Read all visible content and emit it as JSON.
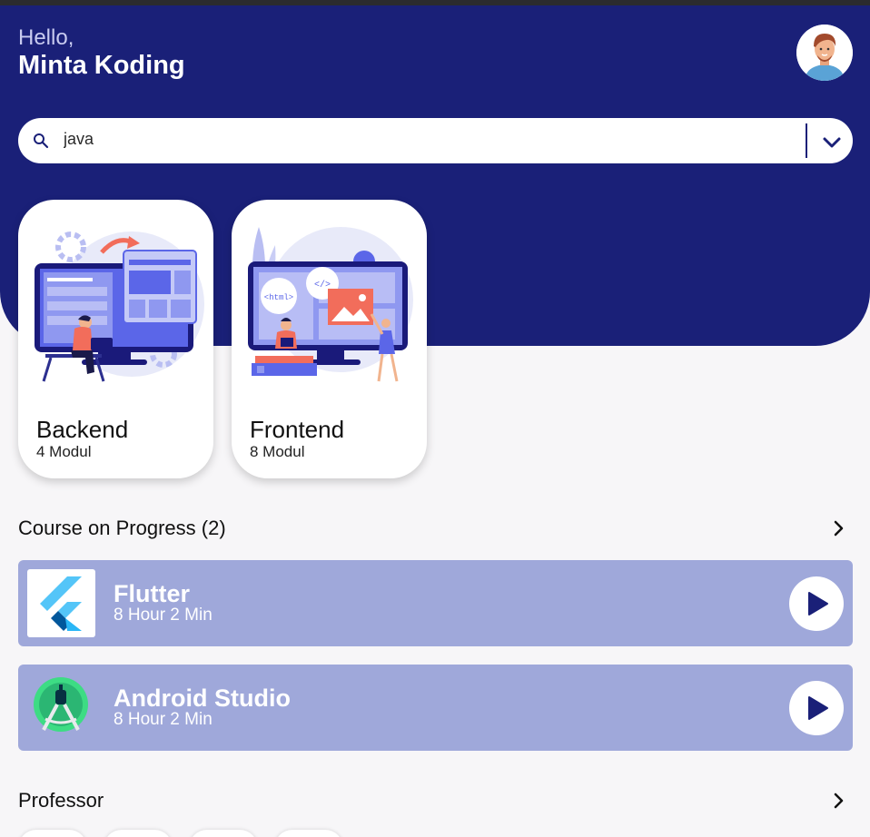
{
  "header": {
    "greeting": "Hello,",
    "username": "Minta Koding"
  },
  "search": {
    "value": "java",
    "placeholder": ""
  },
  "categories": [
    {
      "title": "Backend",
      "subtitle": "4 Modul"
    },
    {
      "title": "Frontend",
      "subtitle": "8 Modul"
    }
  ],
  "progress": {
    "title": "Course on Progress (2)",
    "courses": [
      {
        "name": "Flutter",
        "duration": "8 Hour 2 Min"
      },
      {
        "name": "Android Studio",
        "duration": "8 Hour 2 Min"
      }
    ]
  },
  "professor": {
    "title": "Professor"
  },
  "colors": {
    "primary": "#1a2078",
    "course_bg": "#9fa8da",
    "background": "#f7f6f8"
  }
}
